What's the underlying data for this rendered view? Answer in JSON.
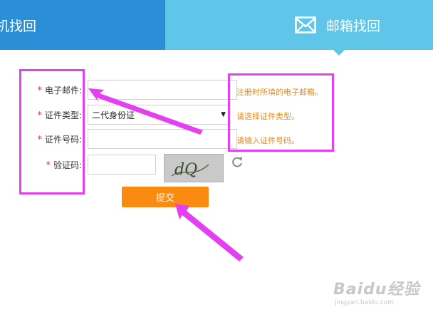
{
  "tabs": {
    "phone": {
      "label": "机找回"
    },
    "email": {
      "label": "邮箱找回"
    }
  },
  "form": {
    "email": {
      "label": "电子邮件:",
      "value": ""
    },
    "id_type": {
      "label": "证件类型:",
      "selected": "二代身份证"
    },
    "id_number": {
      "label": "证件号码:",
      "value": ""
    },
    "captcha": {
      "label": "验证码:",
      "value": "",
      "image_text": "dQ"
    },
    "required_mark": "*",
    "submit_label": "提交"
  },
  "hints": {
    "email": "注册时所填的电子邮箱。",
    "id_type": "请选择证件类型。",
    "id_number": "请输入证件号码。"
  },
  "watermark": {
    "brand": "Baidu经验",
    "url": "jingyan.baidu.com"
  },
  "colors": {
    "tab_active": "#5fc6ea",
    "tab_inactive": "#2a8fd6",
    "submit": "#fb8a10",
    "hint": "#e58a1d",
    "required": "#e0322f",
    "annotation": "#e43ff0"
  }
}
